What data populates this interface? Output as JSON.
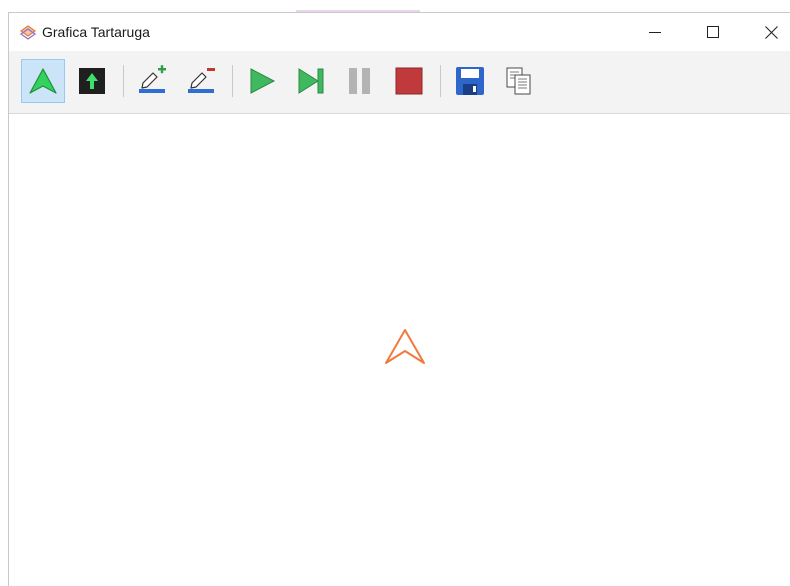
{
  "window": {
    "title": "Grafica Tartaruga"
  },
  "titlebar_buttons": {
    "minimize": "minimize-icon",
    "maximize": "maximize-icon",
    "close": "close-icon"
  },
  "toolbar": {
    "buttons": [
      {
        "icon": "turtle-arrow-icon",
        "active": true,
        "color": "#2ecc5e"
      },
      {
        "icon": "up-arrow-icon",
        "active": false,
        "color": "#2ecc5e"
      },
      {
        "icon": "pen-add-icon",
        "active": false
      },
      {
        "icon": "pen-remove-icon",
        "active": false
      },
      {
        "icon": "play-icon",
        "active": false,
        "color": "#3cb371"
      },
      {
        "icon": "step-icon",
        "active": false,
        "color": "#3cb371"
      },
      {
        "icon": "pause-icon",
        "active": false,
        "color": "#b0b0b0"
      },
      {
        "icon": "stop-icon",
        "active": false,
        "color": "#c0392b"
      },
      {
        "icon": "save-icon",
        "active": false,
        "color": "#2f6fd1"
      },
      {
        "icon": "copy-icon",
        "active": false
      }
    ]
  },
  "canvas": {
    "turtle_icon": "turtle-cursor-icon",
    "turtle_color": "#f07a3c",
    "background": "#ffffff"
  }
}
